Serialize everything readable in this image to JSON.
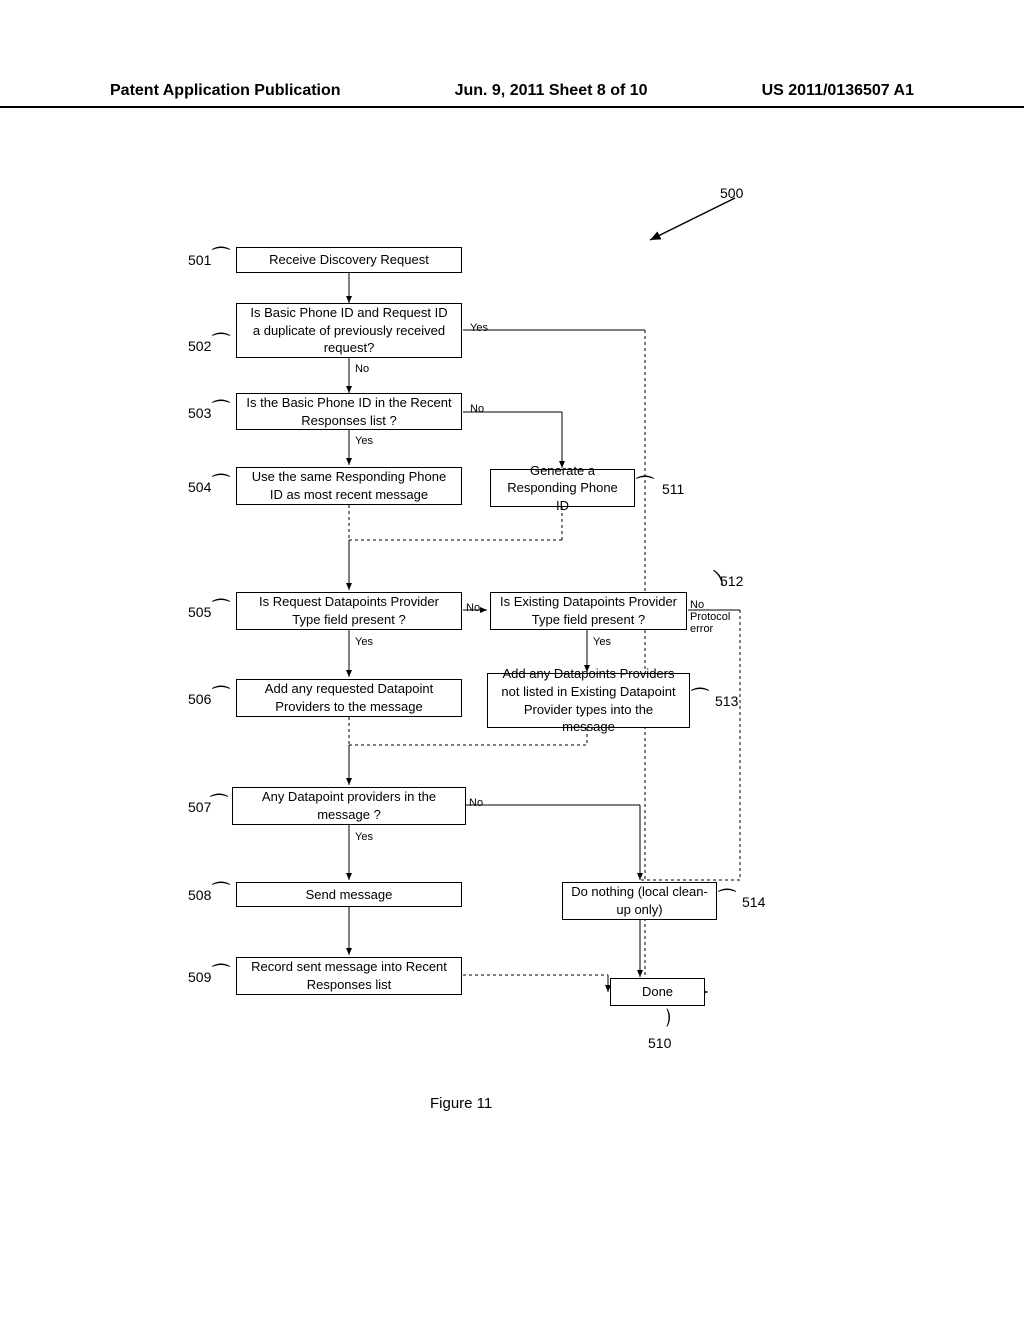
{
  "header": {
    "left": "Patent Application Publication",
    "center": "Jun. 9, 2011  Sheet 8 of 10",
    "right": "US 2011/0136507 A1"
  },
  "refs": {
    "r500": "500",
    "r501": "501",
    "r502": "502",
    "r503": "503",
    "r504": "504",
    "r505": "505",
    "r506": "506",
    "r507": "507",
    "r508": "508",
    "r509": "509",
    "r510": "510",
    "r511": "511",
    "r512": "512",
    "r513": "513",
    "r514": "514"
  },
  "boxes": {
    "b501": "Receive Discovery Request",
    "b502": "Is Basic Phone ID and Request ID a duplicate of previously received request?",
    "b503": "Is the Basic Phone ID in the Recent Responses list ?",
    "b504": "Use the same Responding Phone ID as most recent message",
    "b511": "Generate a Responding Phone ID",
    "b505": "Is Request Datapoints Provider Type field present ?",
    "b512": "Is Existing Datapoints Provider Type field present ?",
    "b506": "Add any requested Datapoint Providers to the message",
    "b513": "Add any Datapoints Providers not listed in Existing Datapoint Provider types into the message",
    "b507": "Any Datapoint providers in the message ?",
    "b508": "Send message",
    "b514": "Do nothing (local clean-up only)",
    "b509": "Record sent message into Recent Responses list",
    "b510": "Done"
  },
  "labels": {
    "yes": "Yes",
    "no": "No",
    "noproto": "No\nProtocol\nerror"
  },
  "caption": "Figure 11"
}
